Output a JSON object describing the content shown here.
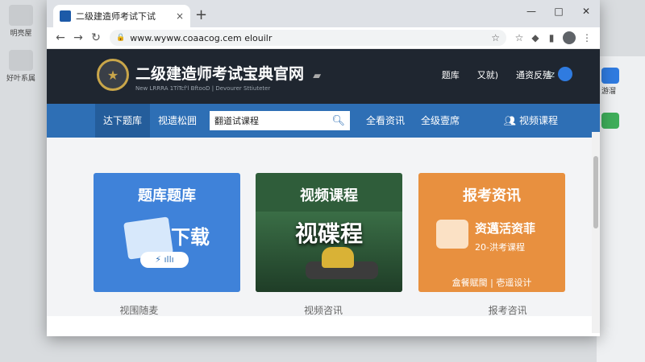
{
  "desktop": {
    "icons": [
      {
        "label": "明亮屋"
      },
      {
        "label": "好叶系属"
      }
    ],
    "right_app_tiles": [
      {
        "label": "游溜",
        "color": "#2f7be0"
      },
      {
        "label": "",
        "color": "#3fae5a"
      }
    ]
  },
  "browser": {
    "tab_title": "二级建造师考试下试",
    "tab_close": "×",
    "new_tab": "+",
    "window_controls": [
      "—",
      "□",
      "✕"
    ],
    "back": "←",
    "forward": "→",
    "reload": "↻",
    "url": "www.wyww.coaacog.cem elouilr",
    "lock": "🔒",
    "star": "☆"
  },
  "site": {
    "title": "二级建造师考试宝典官网",
    "subtitle": "New LRRRA 1TiTcf'l BftooD | Devourer Sttiuteter",
    "nav": [
      "题库",
      "又就)",
      "通资反殖"
    ],
    "user_level": "lz",
    "logo_char": "★"
  },
  "blue_nav": {
    "items": [
      "达下题库",
      "视遗松囲"
    ],
    "search_value": "翻道试课程",
    "links": [
      "全看资讯",
      "全级壹席"
    ],
    "video_link": "视频课程"
  },
  "cards": [
    {
      "title": "题库题库",
      "big": "下载",
      "pill": "⚡ ıllı"
    },
    {
      "title": "视频课程",
      "big": "视碟程"
    },
    {
      "title": "报考资讯",
      "line1": "资邁活资菲",
      "line2": "20-洪考课程",
      "foot": "盒餐赋閩 | 壱遥设计"
    }
  ],
  "bottom_labels": [
    "视围随麦",
    "视频咨讯",
    "报考咨讯"
  ]
}
